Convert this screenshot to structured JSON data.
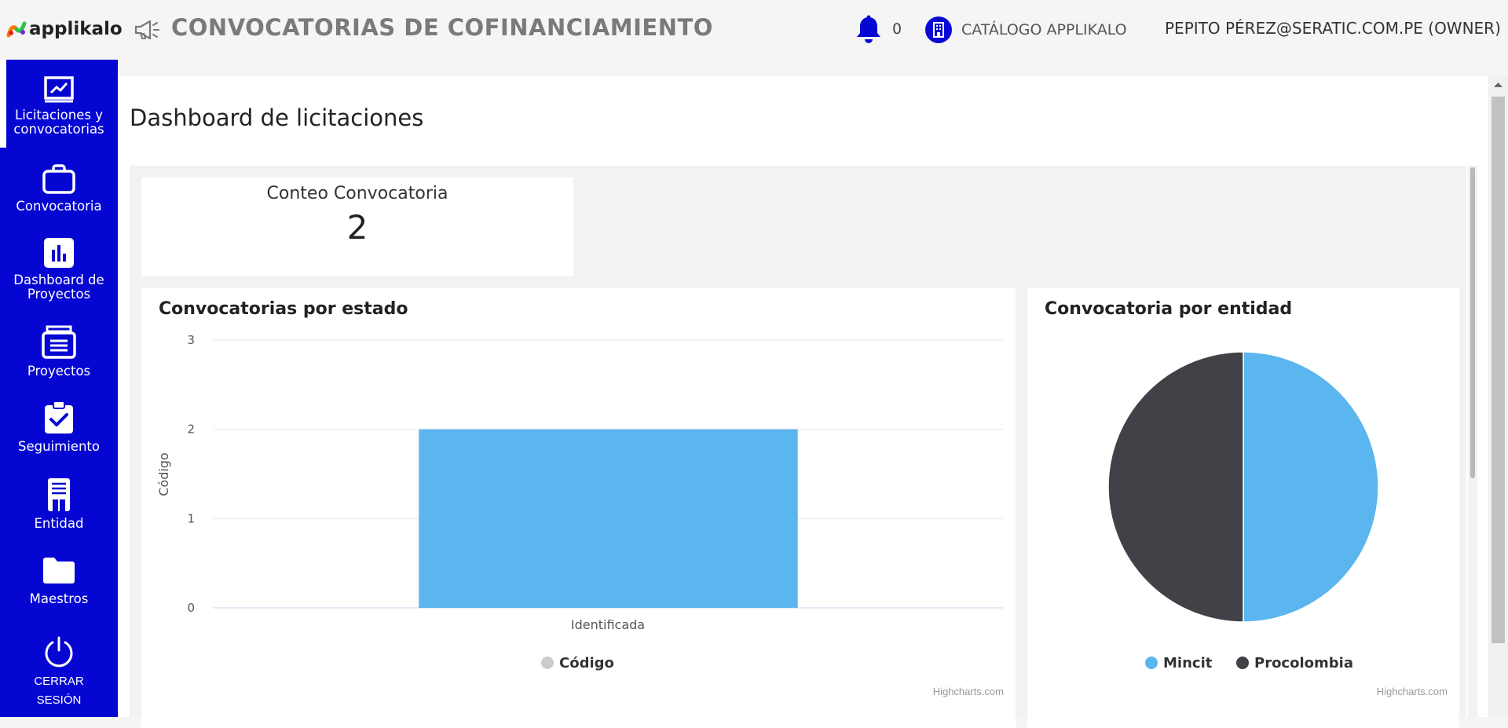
{
  "header": {
    "logo_text": "applikalo",
    "app_title": "CONVOCATORIAS DE COFINANCIAMIENTO",
    "notification_count": "0",
    "catalog_label": "CATÁLOGO APPLIKALO",
    "user_label": "PEPITO PÉREZ@SERATIC.COM.PE (OWNER)"
  },
  "sidebar": {
    "items": [
      {
        "label_line1": "Licitaciones y",
        "label_line2": "convocatorias",
        "icon": "chart-board-icon"
      },
      {
        "label_line1": "Convocatoria",
        "icon": "briefcase-icon"
      },
      {
        "label_line1": "Dashboard de",
        "label_line2": "Proyectos",
        "icon": "bar-chart-icon"
      },
      {
        "label_line1": "Proyectos",
        "icon": "archive-icon"
      },
      {
        "label_line1": "Seguimiento",
        "icon": "clipboard-check-icon"
      },
      {
        "label_line1": "Entidad",
        "icon": "building-icon"
      },
      {
        "label_line1": "Maestros",
        "icon": "folder-icon"
      }
    ],
    "logout": {
      "line1": "CERRAR",
      "line2": "SESIÓN",
      "icon": "power-icon"
    }
  },
  "main": {
    "page_title": "Dashboard de licitaciones",
    "count_card": {
      "title": "Conteo Convocatoria",
      "value": "2"
    }
  },
  "colors": {
    "sidebar": "#0606d2",
    "bar": "#5bb5ee",
    "pie_dark": "#414147",
    "legend_inactive": "#cccccc"
  },
  "chart_data": [
    {
      "type": "bar",
      "title": "Convocatorias por estado",
      "categories": [
        "Identificada"
      ],
      "series": [
        {
          "name": "Código",
          "values": [
            2
          ]
        }
      ],
      "ylabel": "Código",
      "xlabel": "",
      "ylim": [
        0,
        3
      ],
      "yticks": [
        "0",
        "1",
        "2",
        "3"
      ],
      "grid": true,
      "legend": "bottom-center",
      "credits": "Highcharts.com"
    },
    {
      "type": "pie",
      "title": "Convocatoria por entidad",
      "labels": [
        "Mincit",
        "Procolombia"
      ],
      "values": [
        1,
        1
      ],
      "colors": [
        "#5bb5ee",
        "#414147"
      ],
      "legend": "bottom-center",
      "credits": "Highcharts.com"
    }
  ]
}
